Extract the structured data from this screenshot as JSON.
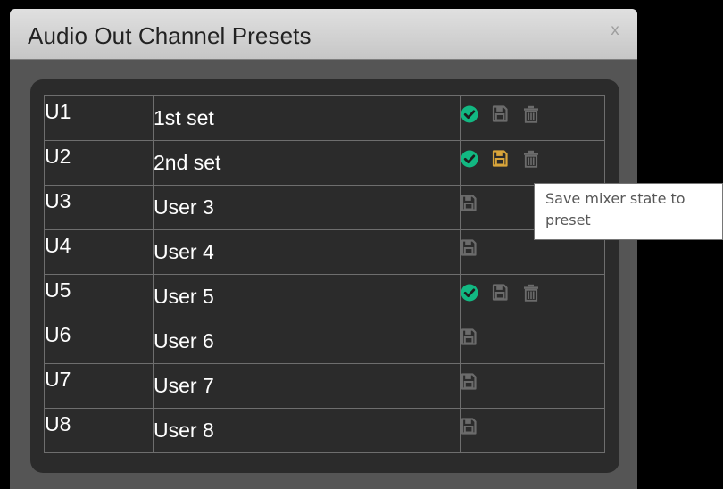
{
  "window": {
    "title": "Audio Out Channel Presets",
    "close_glyph": "x"
  },
  "colors": {
    "check": "#12b882",
    "save_active": "#d9a53a",
    "icon_inactive": "#6b6b6b"
  },
  "presets": [
    {
      "id": "U1",
      "name": "1st set",
      "icons": [
        "check-icon",
        "save-icon",
        "trash-icon"
      ],
      "save_active": false
    },
    {
      "id": "U2",
      "name": "2nd set",
      "icons": [
        "check-icon",
        "save-icon",
        "trash-icon"
      ],
      "save_active": true
    },
    {
      "id": "U3",
      "name": "User 3",
      "icons": [
        "save-icon"
      ],
      "save_active": false
    },
    {
      "id": "U4",
      "name": "User 4",
      "icons": [
        "save-icon"
      ],
      "save_active": false
    },
    {
      "id": "U5",
      "name": "User 5",
      "icons": [
        "check-icon",
        "save-icon",
        "trash-icon"
      ],
      "save_active": false
    },
    {
      "id": "U6",
      "name": "User 6",
      "icons": [
        "save-icon"
      ],
      "save_active": false
    },
    {
      "id": "U7",
      "name": "User 7",
      "icons": [
        "save-icon"
      ],
      "save_active": false
    },
    {
      "id": "U8",
      "name": "User 8",
      "icons": [
        "save-icon"
      ],
      "save_active": false
    }
  ],
  "tooltip": {
    "text": "Save mixer state to preset"
  }
}
